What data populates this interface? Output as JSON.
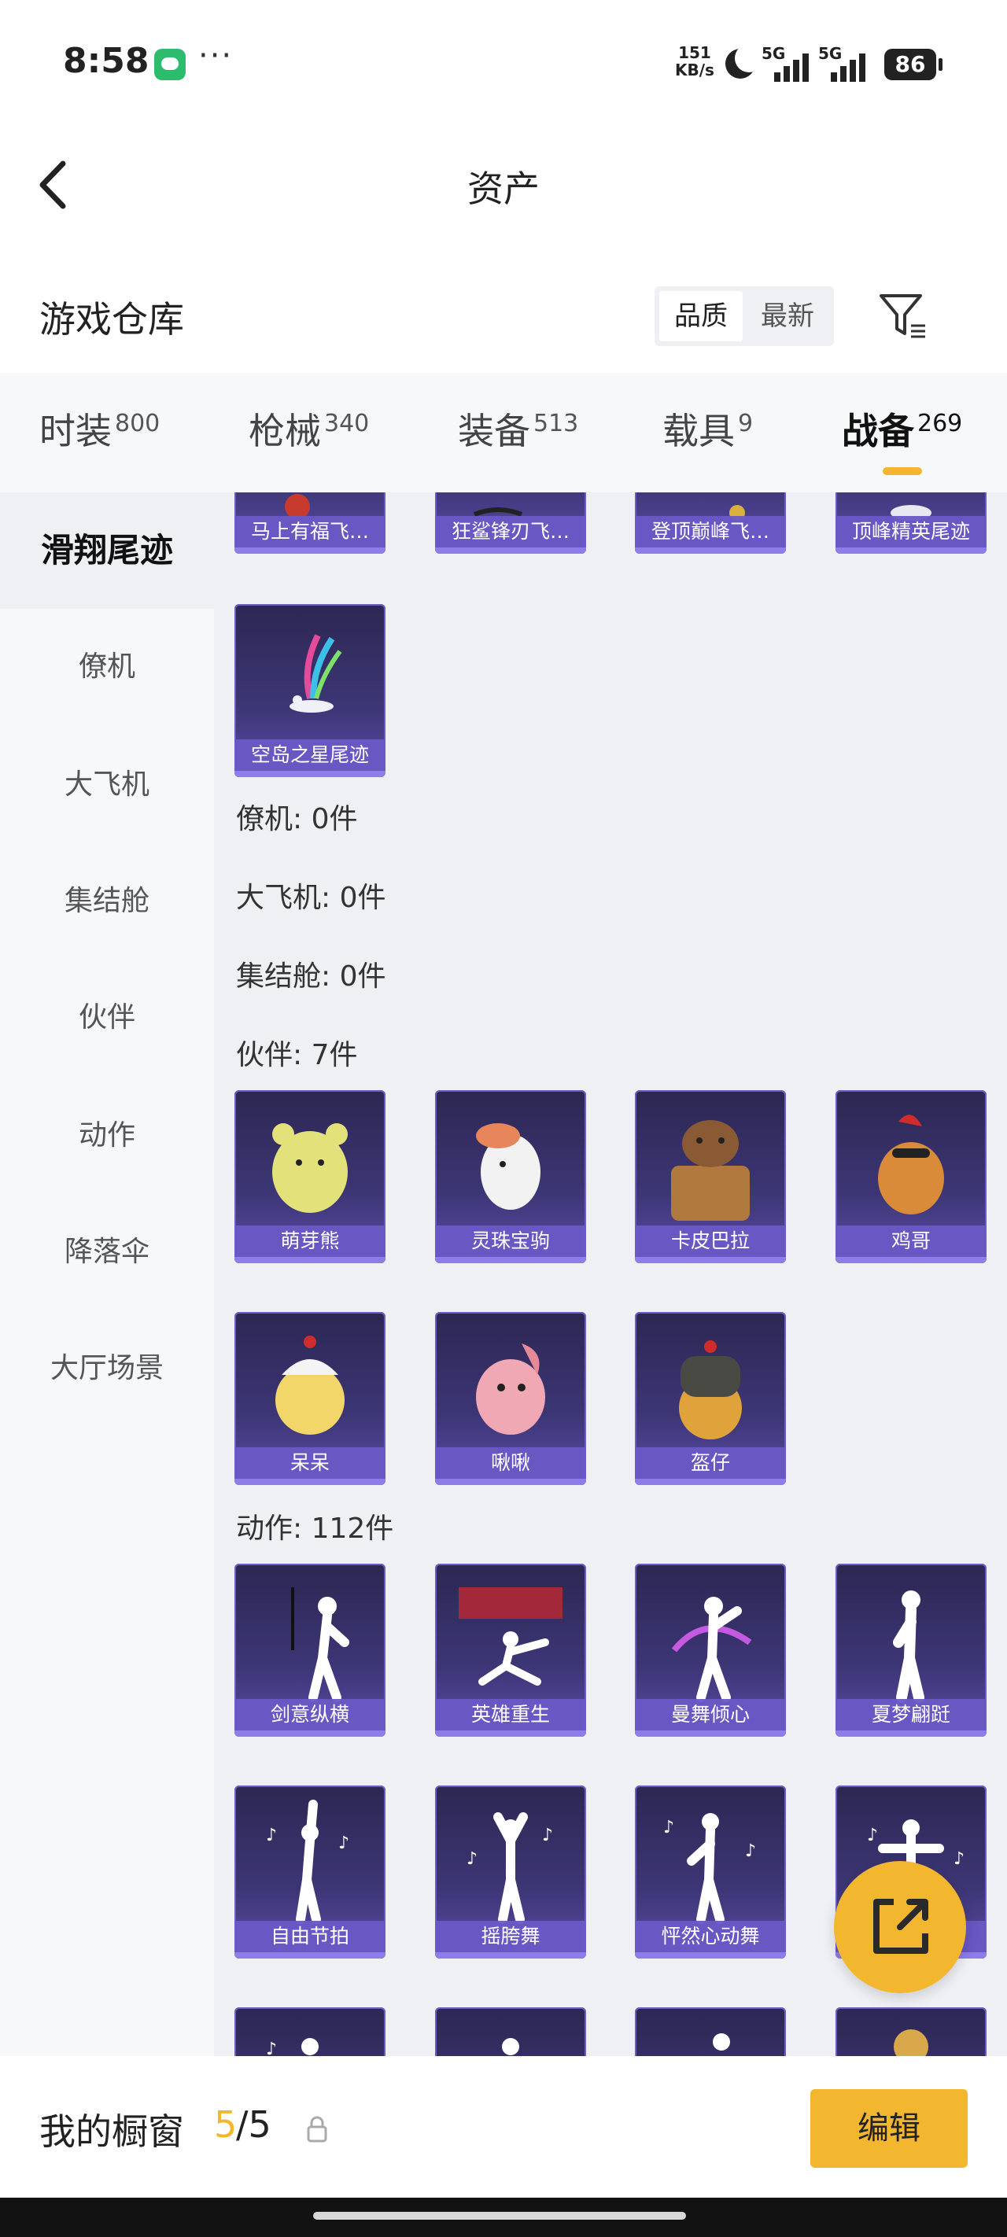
{
  "status_bar": {
    "time": "8:58",
    "dots": "···",
    "net_speed_value": "151",
    "net_speed_unit": "KB/s",
    "sim1": "5G",
    "sim2": "5G",
    "battery": "86"
  },
  "nav": {
    "title": "资产"
  },
  "warehouse": {
    "title": "游戏仓库",
    "sort_options": [
      "品质",
      "最新"
    ],
    "selected_sort": "品质"
  },
  "tabs": [
    {
      "label": "时装",
      "count": "800"
    },
    {
      "label": "枪械",
      "count": "340"
    },
    {
      "label": "装备",
      "count": "513"
    },
    {
      "label": "载具",
      "count": "9"
    },
    {
      "label": "战备",
      "count": "269",
      "active": true
    }
  ],
  "sidebar": {
    "items": [
      "滑翔尾迹",
      "僚机",
      "大飞机",
      "集结舱",
      "伙伴",
      "动作",
      "降落伞",
      "大厅场景"
    ],
    "active": "滑翔尾迹"
  },
  "glide_trails": {
    "top_partial": [
      "马上有福飞…",
      "狂鲨锋刃飞…",
      "登顶巅峰飞…",
      "顶峰精英尾迹"
    ],
    "items": [
      "空岛之星尾迹"
    ]
  },
  "sections": {
    "wingman": "僚机: 0件",
    "big_plane": "大飞机: 0件",
    "pod": "集结舱: 0件",
    "partner": "伙伴: 7件",
    "actions": "动作: 112件"
  },
  "partners": [
    "萌芽熊",
    "灵珠宝驹",
    "卡皮巴拉",
    "鸡哥",
    "呆呆",
    "啾啾",
    "盔仔"
  ],
  "actions": [
    "剑意纵横",
    "英雄重生",
    "曼舞倾心",
    "夏梦翩跹",
    "自由节拍",
    "摇胯舞",
    "怦然心动舞",
    ""
  ],
  "bottom": {
    "showcase_label": "我的橱窗",
    "count": "5",
    "total": "/5",
    "edit_label": "编辑"
  },
  "colors": {
    "accent": "#f3b62f",
    "card_dark": "#2c2752",
    "card_label": "#6a58c6"
  }
}
